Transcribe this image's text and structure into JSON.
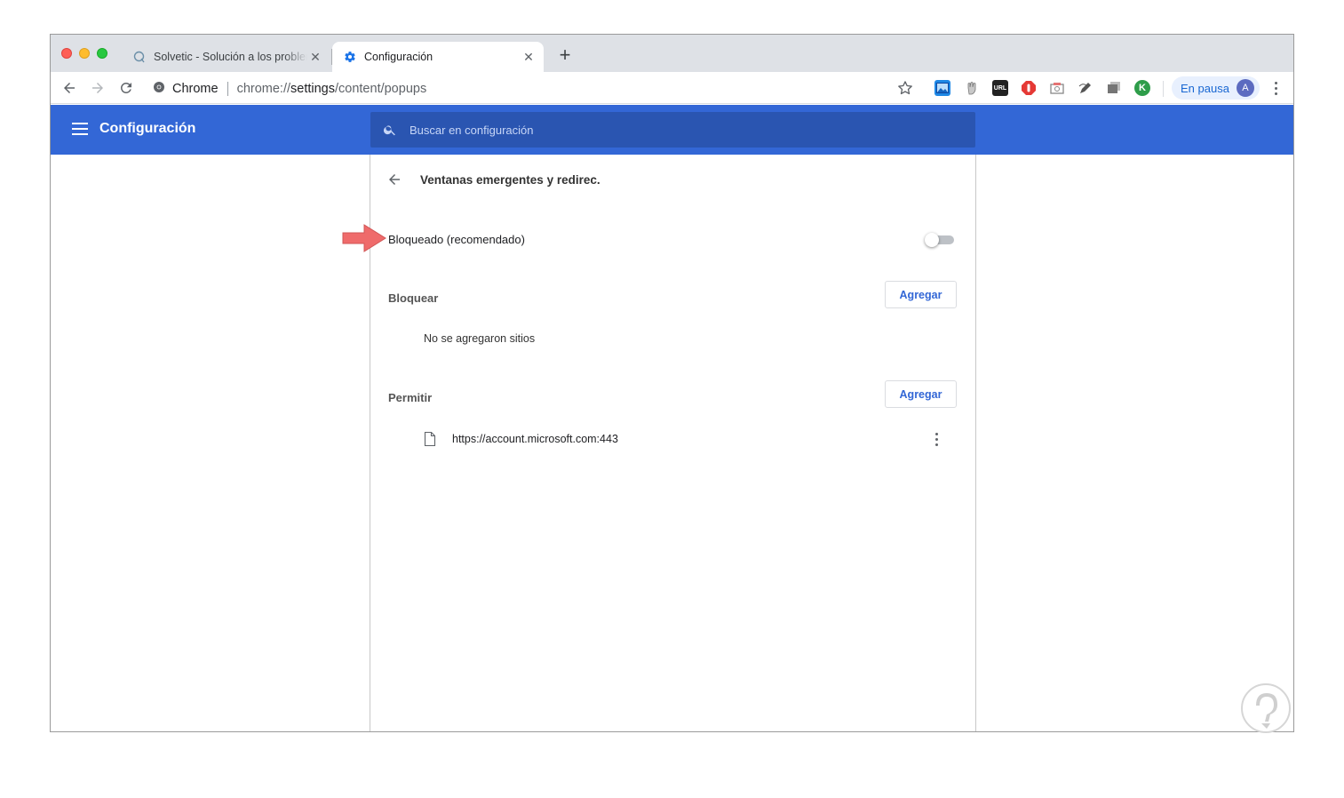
{
  "tabs": {
    "inactive": {
      "title": "Solvetic - Solución a los problemas",
      "favicon": "solvetic-icon",
      "close": "✕"
    },
    "active": {
      "title": "Configuración",
      "favicon": "gear-icon",
      "close": "✕"
    },
    "new_tab": "+"
  },
  "toolbar": {
    "site_label": "Chrome",
    "url_scheme": "chrome://",
    "url_host": "settings",
    "url_path": "/content/popups",
    "extensions": [
      "image-extension-icon",
      "hand-extension-icon",
      "url-extension-icon",
      "adblock-extension-icon",
      "screenshot-extension-icon",
      "pen-extension-icon",
      "tabs-extension-icon",
      "k-extension-icon"
    ],
    "url_ext_text": "URL",
    "k_ext_text": "K",
    "profile_label": "En pausa",
    "profile_initial": "A"
  },
  "header": {
    "title": "Configuración",
    "search_placeholder": "Buscar en configuración"
  },
  "page": {
    "title": "Ventanas emergentes y redirec.",
    "blocked_label": "Bloqueado (recomendado)",
    "blocked_toggle_on": false,
    "block_section": {
      "label": "Bloquear",
      "add_label": "Agregar",
      "empty_text": "No se agregaron sitios"
    },
    "allow_section": {
      "label": "Permitir",
      "add_label": "Agregar",
      "sites": [
        "https://account.microsoft.com:443"
      ]
    }
  },
  "colors": {
    "header_blue": "#3367d6",
    "search_blue": "#2a55b1",
    "arrow_red": "#ef6b6b"
  }
}
